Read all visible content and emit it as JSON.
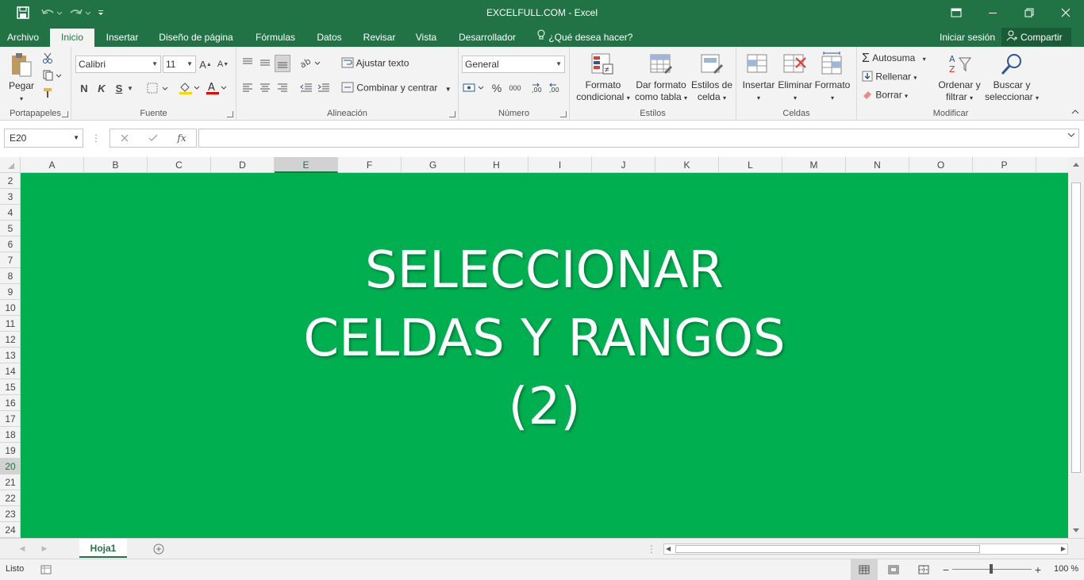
{
  "window": {
    "title": "EXCELFULL.COM - Excel"
  },
  "tabs": [
    "Archivo",
    "Inicio",
    "Insertar",
    "Diseño de página",
    "Fórmulas",
    "Datos",
    "Revisar",
    "Vista",
    "Desarrollador"
  ],
  "tell_me": "¿Qué desea hacer?",
  "sign_in": "Iniciar sesión",
  "share": "Compartir",
  "ribbon": {
    "clipboard": {
      "paste": "Pegar",
      "label": "Portapapeles"
    },
    "font": {
      "name": "Calibri",
      "size": "11",
      "bold": "N",
      "italic": "K",
      "underline": "S",
      "label": "Fuente"
    },
    "alignment": {
      "wrap": "Ajustar texto",
      "merge": "Combinar y centrar",
      "label": "Alineación"
    },
    "number": {
      "format": "General",
      "percent": "%",
      "thousands": "000",
      "label": "Número"
    },
    "styles": {
      "cond_format_1": "Formato",
      "cond_format_2": "condicional",
      "table_format_1": "Dar formato",
      "table_format_2": "como tabla",
      "cell_styles_1": "Estilos de",
      "cell_styles_2": "celda",
      "label": "Estilos"
    },
    "cells": {
      "insert": "Insertar",
      "delete": "Eliminar",
      "format": "Formato",
      "label": "Celdas"
    },
    "editing": {
      "autosum": "Autosuma",
      "fill": "Rellenar",
      "clear": "Borrar",
      "sort_1": "Ordenar y",
      "sort_2": "filtrar",
      "find_1": "Buscar y",
      "find_2": "seleccionar",
      "label": "Modificar"
    }
  },
  "formula_bar": {
    "name_box": "E20",
    "fx": "fx",
    "formula": ""
  },
  "columns": [
    "A",
    "B",
    "C",
    "D",
    "E",
    "F",
    "G",
    "H",
    "I",
    "J",
    "K",
    "L",
    "M",
    "N",
    "O",
    "P"
  ],
  "rows": [
    "2",
    "3",
    "4",
    "5",
    "6",
    "7",
    "8",
    "9",
    "10",
    "11",
    "12",
    "13",
    "14",
    "15",
    "16",
    "17",
    "18",
    "19",
    "20",
    "21",
    "22",
    "23",
    "24"
  ],
  "selected_column": "E",
  "selected_row": "20",
  "banner": {
    "line1": "SELECCIONAR",
    "line2": "CELDAS Y RANGOS",
    "line3": "(2)",
    "background": "#00b050",
    "color": "#ffffff"
  },
  "sheet_tab": "Hoja1",
  "status": {
    "ready": "Listo",
    "zoom": "100 %"
  },
  "colors": {
    "accent": "#217346"
  }
}
